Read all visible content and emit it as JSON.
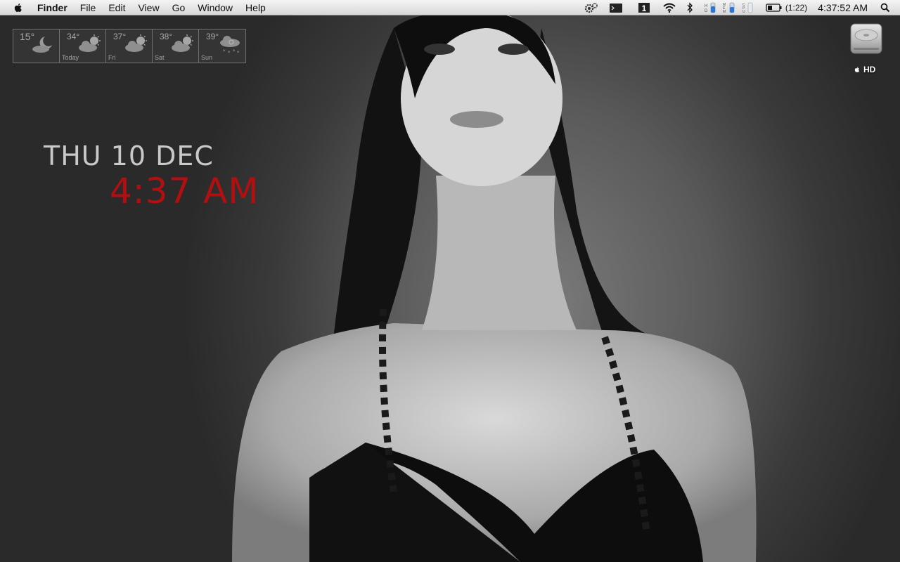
{
  "menubar": {
    "app_name": "Finder",
    "menus": [
      "File",
      "Edit",
      "View",
      "Go",
      "Window",
      "Help"
    ],
    "status_icons": [
      "gears-icon",
      "terminal-icon",
      "one-icon",
      "wifi-icon",
      "bluetooth-icon",
      "hd-meter-icon",
      "mem-meter-icon",
      "cpu-meter-icon",
      "battery-icon",
      "spotlight-icon"
    ],
    "battery_time": "(1:22)",
    "clock": "4:37:52 AM"
  },
  "weather": {
    "days": [
      {
        "temp": "15°",
        "label": "",
        "icon": "moon-cloud-icon"
      },
      {
        "temp": "34°",
        "label": "Today",
        "icon": "sun-cloud-icon"
      },
      {
        "temp": "37°",
        "label": "Fri",
        "icon": "sun-cloud-icon"
      },
      {
        "temp": "38°",
        "label": "Sat",
        "icon": "sun-cloud-icon"
      },
      {
        "temp": "39°",
        "label": "Sun",
        "icon": "snow-cloud-icon"
      }
    ]
  },
  "datetime": {
    "date": "THU 10 DEC",
    "time": "4:37 AM"
  },
  "desktop_icons": {
    "hd_label": "HD"
  },
  "colors": {
    "time_red": "#b10f10",
    "date_gray": "#c9c9c9"
  }
}
